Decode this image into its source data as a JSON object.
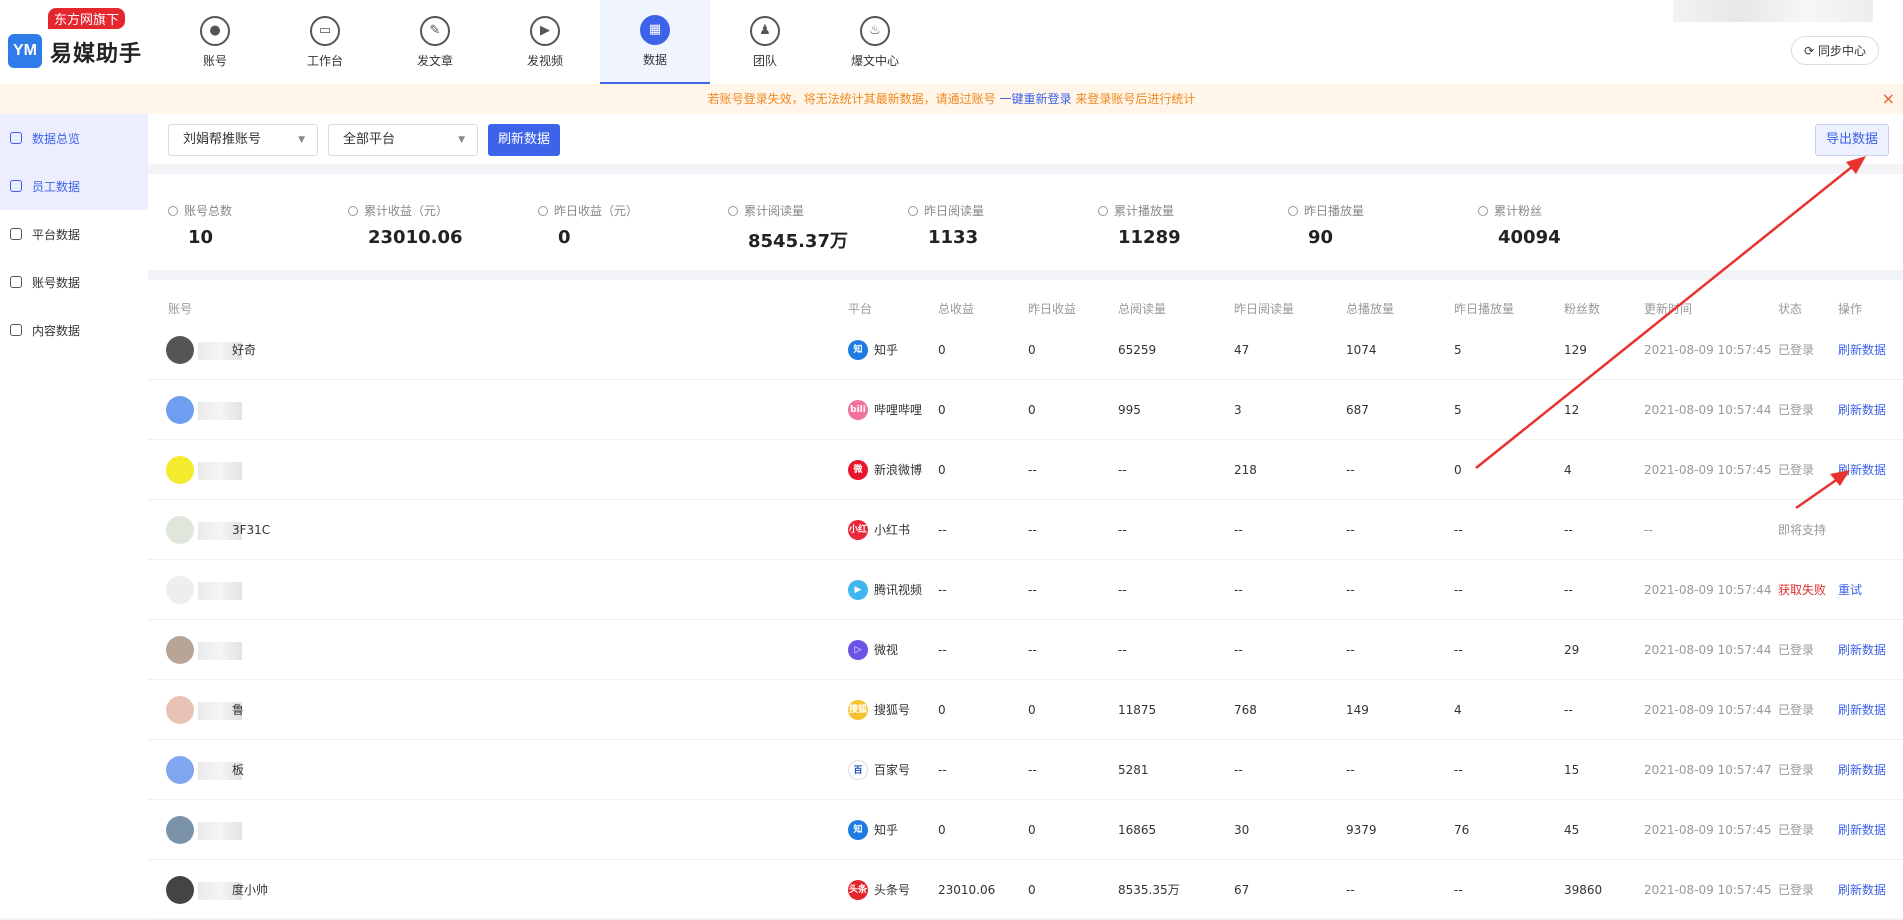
{
  "app": {
    "badge": "东方网旗下",
    "logo_mark": "YM",
    "name": "易媒助手"
  },
  "nav": [
    {
      "label": "账号",
      "glyph": "●"
    },
    {
      "label": "工作台",
      "glyph": "▭"
    },
    {
      "label": "发文章",
      "glyph": "✎"
    },
    {
      "label": "发视频",
      "glyph": "▶"
    },
    {
      "label": "数据",
      "glyph": "▦",
      "active": true
    },
    {
      "label": "团队",
      "glyph": "♟"
    },
    {
      "label": "爆文中心",
      "glyph": "♨"
    }
  ],
  "sync_label": "⟳ 同步中心",
  "notice": {
    "text1": "若账号登录失效，将无法统计其最新数据，请通过账号 ",
    "link": "一键重新登录",
    "text2": " 来登录账号后进行统计",
    "close": "×"
  },
  "sidebar": [
    {
      "label": "数据总览",
      "active": true
    },
    {
      "label": "员工数据",
      "active": true
    },
    {
      "label": "平台数据"
    },
    {
      "label": "账号数据"
    },
    {
      "label": "内容数据"
    }
  ],
  "filters": {
    "account": "刘娟帮推账号",
    "platform": "全部平台",
    "refresh": "刷新数据",
    "export": "导出数据",
    "caret": "▼"
  },
  "stats": [
    {
      "label": "账号总数",
      "value": "10"
    },
    {
      "label": "累计收益（元）",
      "value": "23010.06"
    },
    {
      "label": "昨日收益（元）",
      "value": "0"
    },
    {
      "label": "累计阅读量",
      "value": "8545.37万"
    },
    {
      "label": "昨日阅读量",
      "value": "1133"
    },
    {
      "label": "累计播放量",
      "value": "11289"
    },
    {
      "label": "昨日播放量",
      "value": "90"
    },
    {
      "label": "累计粉丝",
      "value": "40094"
    }
  ],
  "table": {
    "headers": [
      "账号",
      "平台",
      "总收益",
      "昨日收益",
      "总阅读量",
      "昨日阅读量",
      "总播放量",
      "昨日播放量",
      "粉丝数",
      "更新时间",
      "状态",
      "操作"
    ],
    "rows": [
      {
        "name": "好奇",
        "avatar": "#555555",
        "platform": "知乎",
        "pf_color": "#1e7be4",
        "pf_glyph": "知",
        "total_income": "0",
        "y_income": "0",
        "total_read": "65259",
        "y_read": "47",
        "total_play": "1074",
        "y_play": "5",
        "fans": "129",
        "updated": "2021-08-09 10:57:45",
        "status": "已登录",
        "status_type": "ok",
        "op": "刷新数据"
      },
      {
        "name": "",
        "avatar": "#6f9df0",
        "platform": "哔哩哔哩",
        "pf_color": "#f0719a",
        "pf_glyph": "bili",
        "total_income": "0",
        "y_income": "0",
        "total_read": "995",
        "y_read": "3",
        "total_play": "687",
        "y_play": "5",
        "fans": "12",
        "updated": "2021-08-09 10:57:44",
        "status": "已登录",
        "status_type": "ok",
        "op": "刷新数据"
      },
      {
        "name": "",
        "avatar": "#f4ea2e",
        "platform": "新浪微博",
        "pf_color": "#e6162d",
        "pf_glyph": "微",
        "total_income": "0",
        "y_income": "--",
        "total_read": "--",
        "y_read": "218",
        "total_play": "--",
        "y_play": "0",
        "fans": "4",
        "updated": "2021-08-09 10:57:45",
        "status": "已登录",
        "status_type": "ok",
        "op": "刷新数据"
      },
      {
        "name": "3F31C",
        "avatar": "#dfe6dc",
        "platform": "小红书",
        "pf_color": "#e9263a",
        "pf_glyph": "小红书",
        "total_income": "--",
        "y_income": "--",
        "total_read": "--",
        "y_read": "--",
        "total_play": "--",
        "y_play": "--",
        "fans": "--",
        "updated": "--",
        "status": "即将支持",
        "status_type": "ok",
        "op": ""
      },
      {
        "name": "",
        "avatar": "#eeeeee",
        "platform": "腾讯视频",
        "pf_color": "#3fb6ef",
        "pf_glyph": "▶",
        "total_income": "--",
        "y_income": "--",
        "total_read": "--",
        "y_read": "--",
        "total_play": "--",
        "y_play": "--",
        "fans": "--",
        "updated": "2021-08-09 10:57:44",
        "status": "获取失败",
        "status_type": "fail",
        "op": "重试"
      },
      {
        "name": "",
        "avatar": "#b9a596",
        "platform": "微视",
        "pf_color": "#6b53e8",
        "pf_glyph": "▷",
        "total_income": "--",
        "y_income": "--",
        "total_read": "--",
        "y_read": "--",
        "total_play": "--",
        "y_play": "--",
        "fans": "29",
        "updated": "2021-08-09 10:57:44",
        "status": "已登录",
        "status_type": "ok",
        "op": "刷新数据"
      },
      {
        "name": "鲁",
        "avatar": "#e9c2b6",
        "platform": "搜狐号",
        "pf_color": "#f4c22e",
        "pf_glyph": "搜狐",
        "total_income": "0",
        "y_income": "0",
        "total_read": "11875",
        "y_read": "768",
        "total_play": "149",
        "y_play": "4",
        "fans": "--",
        "updated": "2021-08-09 10:57:44",
        "status": "已登录",
        "status_type": "ok",
        "op": "刷新数据"
      },
      {
        "name": "板",
        "avatar": "#7fa6ee",
        "platform": "百家号",
        "pf_color": "#ffffff",
        "pf_glyph": "百",
        "total_income": "--",
        "y_income": "--",
        "total_read": "5281",
        "y_read": "--",
        "total_play": "--",
        "y_play": "--",
        "fans": "15",
        "updated": "2021-08-09 10:57:47",
        "status": "已登录",
        "status_type": "ok",
        "op": "刷新数据"
      },
      {
        "name": "",
        "avatar": "#7b93a8",
        "platform": "知乎",
        "pf_color": "#1e7be4",
        "pf_glyph": "知",
        "total_income": "0",
        "y_income": "0",
        "total_read": "16865",
        "y_read": "30",
        "total_play": "9379",
        "y_play": "76",
        "fans": "45",
        "updated": "2021-08-09 10:57:45",
        "status": "已登录",
        "status_type": "ok",
        "op": "刷新数据"
      },
      {
        "name": "度小帅",
        "avatar": "#444444",
        "platform": "头条号",
        "pf_color": "#e4262d",
        "pf_glyph": "头条",
        "total_income": "23010.06",
        "y_income": "0",
        "total_read": "8535.35万",
        "y_read": "67",
        "total_play": "--",
        "y_play": "--",
        "fans": "39860",
        "updated": "2021-08-09 10:57:45",
        "status": "已登录",
        "status_type": "ok",
        "op": "刷新数据"
      }
    ]
  },
  "colors": {
    "accent": "#3d63e8",
    "annotation_arrow": "#e8322d",
    "notice_text": "#f08a24"
  }
}
